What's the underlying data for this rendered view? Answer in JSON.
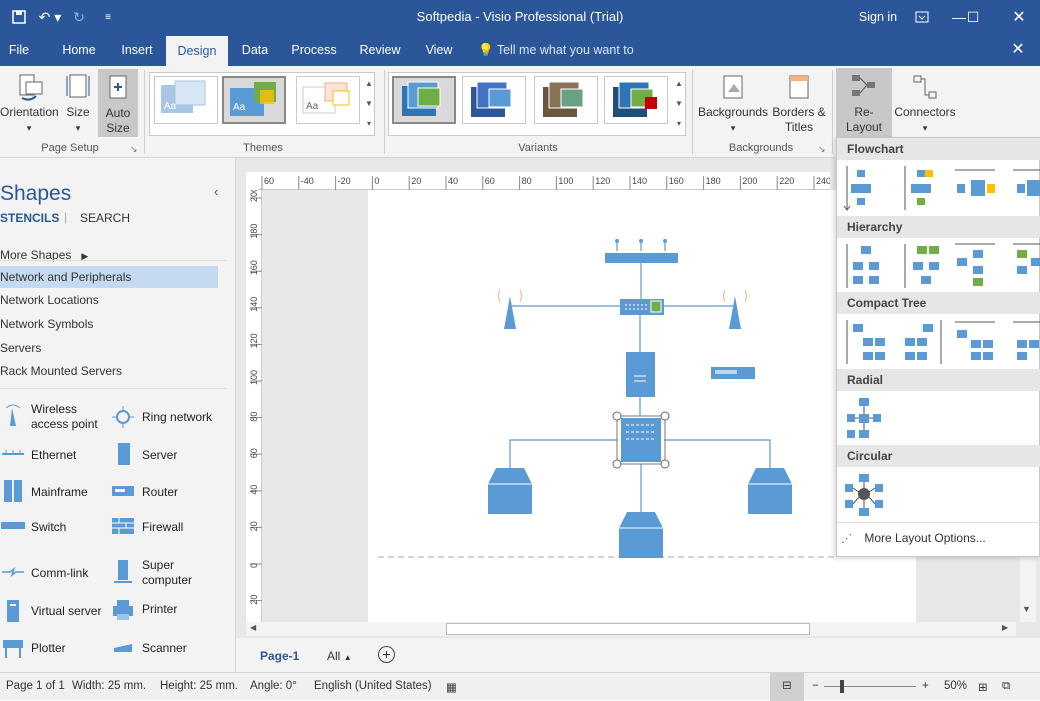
{
  "window": {
    "title": "Softpedia - Visio Professional (Trial)",
    "sign_in": "Sign in"
  },
  "tabs": [
    {
      "label": "File"
    },
    {
      "label": "Home"
    },
    {
      "label": "Insert"
    },
    {
      "label": "Design"
    },
    {
      "label": "Data"
    },
    {
      "label": "Process"
    },
    {
      "label": "Review"
    },
    {
      "label": "View"
    }
  ],
  "tell_me": "Tell me what you want to do",
  "ribbon": {
    "orientation": "Orientation",
    "size": "Size",
    "auto_size": "Auto Size",
    "page_setup": "Page Setup",
    "themes": "Themes",
    "variants": "Variants",
    "backgrounds": "Backgrounds",
    "borders_titles": "Borders & Titles",
    "backgrounds_group": "Backgrounds",
    "relayout": "Re-Layout Page",
    "connectors": "Connectors"
  },
  "shapes_panel": {
    "title": "Shapes",
    "stencils": "STENCILS",
    "search": "SEARCH",
    "more_shapes": "More Shapes",
    "stencil_list": [
      "Network and Peripherals",
      "Network Locations",
      "Network Symbols",
      "Servers",
      "Rack Mounted Servers"
    ],
    "shapes": [
      {
        "label": "Wireless access point",
        "icon": "wireless-icon"
      },
      {
        "label": "Ring network",
        "icon": "ring-icon"
      },
      {
        "label": "Ethernet",
        "icon": "ethernet-icon"
      },
      {
        "label": "Server",
        "icon": "server-icon"
      },
      {
        "label": "Mainframe",
        "icon": "mainframe-icon"
      },
      {
        "label": "Router",
        "icon": "router-icon"
      },
      {
        "label": "Switch",
        "icon": "switch-icon"
      },
      {
        "label": "Firewall",
        "icon": "firewall-icon"
      },
      {
        "label": "Comm-link",
        "icon": "commlink-icon"
      },
      {
        "label": "Super computer",
        "icon": "supercomputer-icon"
      },
      {
        "label": "Virtual server",
        "icon": "virtualserver-icon"
      },
      {
        "label": "Printer",
        "icon": "printer-icon"
      },
      {
        "label": "Plotter",
        "icon": "plotter-icon"
      },
      {
        "label": "Scanner",
        "icon": "scanner-icon"
      }
    ]
  },
  "ruler": {
    "h": [
      "60",
      "-40",
      "-20",
      "0",
      "20",
      "40",
      "60",
      "80",
      "100",
      "120",
      "140",
      "160",
      "180",
      "200",
      "220",
      "240"
    ],
    "v": [
      "200",
      "180",
      "160",
      "140",
      "120",
      "100",
      "80",
      "60",
      "40",
      "20",
      "0",
      "20"
    ]
  },
  "layout_menu": {
    "sections": [
      "Flowchart",
      "Hierarchy",
      "Compact Tree",
      "Radial",
      "Circular"
    ],
    "more": "More Layout Options..."
  },
  "page_tabs": {
    "page1": "Page-1",
    "all": "All"
  },
  "status": {
    "page": "Page 1 of 1",
    "width": "Width: 25 mm.",
    "height": "Height: 25 mm.",
    "angle": "Angle: 0°",
    "language": "English (United States)",
    "zoom": "50%"
  },
  "colors": {
    "brand": "#2b579a",
    "shape": "#5b9bd5"
  }
}
